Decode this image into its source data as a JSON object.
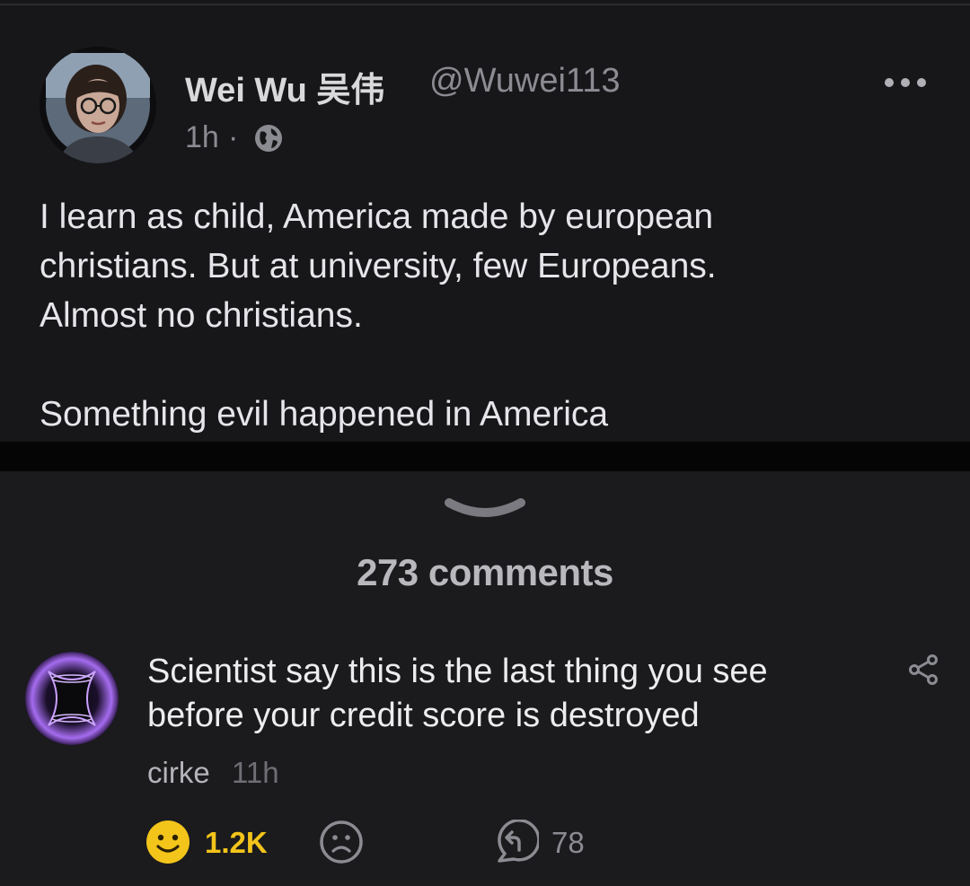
{
  "tweet": {
    "name": "Wei Wu 吴伟",
    "handle": "@Wuwei113",
    "time": "1h",
    "separator_dot": "·",
    "visibility_icon": "globe-icon",
    "more_icon": "more-icon",
    "lines": [
      "I learn as child, America made by european",
      "christians. But at university, few Europeans.",
      "Almost no christians.",
      "Something evil happened in America"
    ]
  },
  "comments": {
    "collapse_icon": "chevron-down-icon",
    "count_label": "273 comments",
    "items": [
      {
        "text_lines": [
          "Scientist say this is the last thing you see",
          "before your credit score is destroyed"
        ],
        "author": "cirke",
        "time": "11h",
        "share_icon": "share-icon",
        "likes": "1.2K",
        "like_icon": "smile-icon",
        "dislike_icon": "frown-icon",
        "reply_icon": "reply-icon",
        "replies": "78"
      }
    ]
  },
  "colors": {
    "background": "#1b1b1e",
    "tweet_background": "#17171a",
    "separator": "#050505",
    "like_accent": "#f3c41a",
    "avatar_glow": "#a56cf0"
  }
}
